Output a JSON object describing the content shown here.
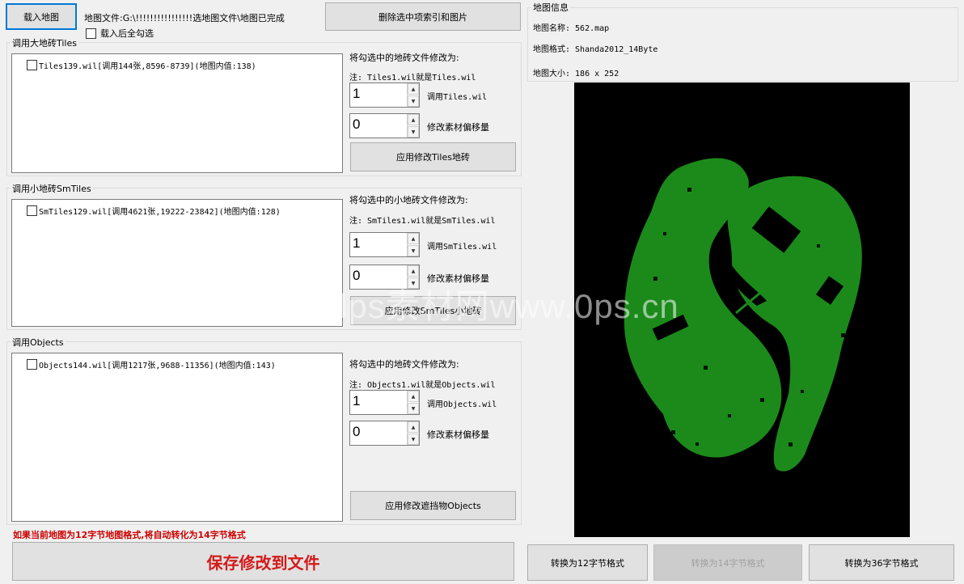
{
  "top": {
    "load_button": "载入地图",
    "map_file": "地图文件:G:\\!!!!!!!!!!!!!!!!选地图文件\\地图已完成",
    "delete_button": "删除选中项索引和图片",
    "select_all_label": "载入后全勾选"
  },
  "tiles_group": {
    "title": "调用大地砖Tiles",
    "item": "Tiles139.wil[调用144张,8596-8739](地图内值:138)",
    "heading": "将勾选中的地砖文件修改为:",
    "note": "注: Tiles1.wil就是Tiles.wil",
    "spin1_value": "1",
    "spin1_label": "调用Tiles.wil",
    "spin2_value": "0",
    "spin2_label": "修改素材偏移量",
    "apply_button": "应用修改Tiles地砖"
  },
  "smtiles_group": {
    "title": "调用小地砖SmTiles",
    "item": "SmTiles129.wil[调用4621张,19222-23842](地图内值:128)",
    "heading": "将勾选中的小地砖文件修改为:",
    "note": "注: SmTiles1.wil就是SmTiles.wil",
    "spin1_value": "1",
    "spin1_label": "调用SmTiles.wil",
    "spin2_value": "0",
    "spin2_label": "修改素材偏移量",
    "apply_button": "应用修改SmTiles小地砖"
  },
  "objects_group": {
    "title": "调用Objects",
    "item": "Objects144.wil[调用1217张,9688-11356](地图内值:143)",
    "heading": "将勾选中的地砖文件修改为:",
    "note": "注: Objects1.wil就是Objects.wil",
    "spin1_value": "1",
    "spin1_label": "调用Objects.wil",
    "spin2_value": "0",
    "spin2_label": "修改素材偏移量",
    "apply_button": "应用修改遮挡物Objects"
  },
  "warning": "如果当前地图为12字节地图格式,将自动转化为14字节格式",
  "save_button": "保存修改到文件",
  "map_info": {
    "title": "地图信息",
    "name": "地图名称: 562.map",
    "format": "地图格式: Shanda2012_14Byte",
    "size": "地图大小: 186 x 252"
  },
  "convert": {
    "to12": "转换为12字节格式",
    "to14": "转换为14字节格式",
    "to36": "转换为36字节格式"
  },
  "watermark": "lps素材网www.0ps.cn",
  "colors": {
    "map_background": "#000000",
    "map_fill": "#1b8a1b",
    "warning_text": "#cc0000",
    "save_text": "#d41a1a",
    "focus_border": "#0078d7"
  }
}
